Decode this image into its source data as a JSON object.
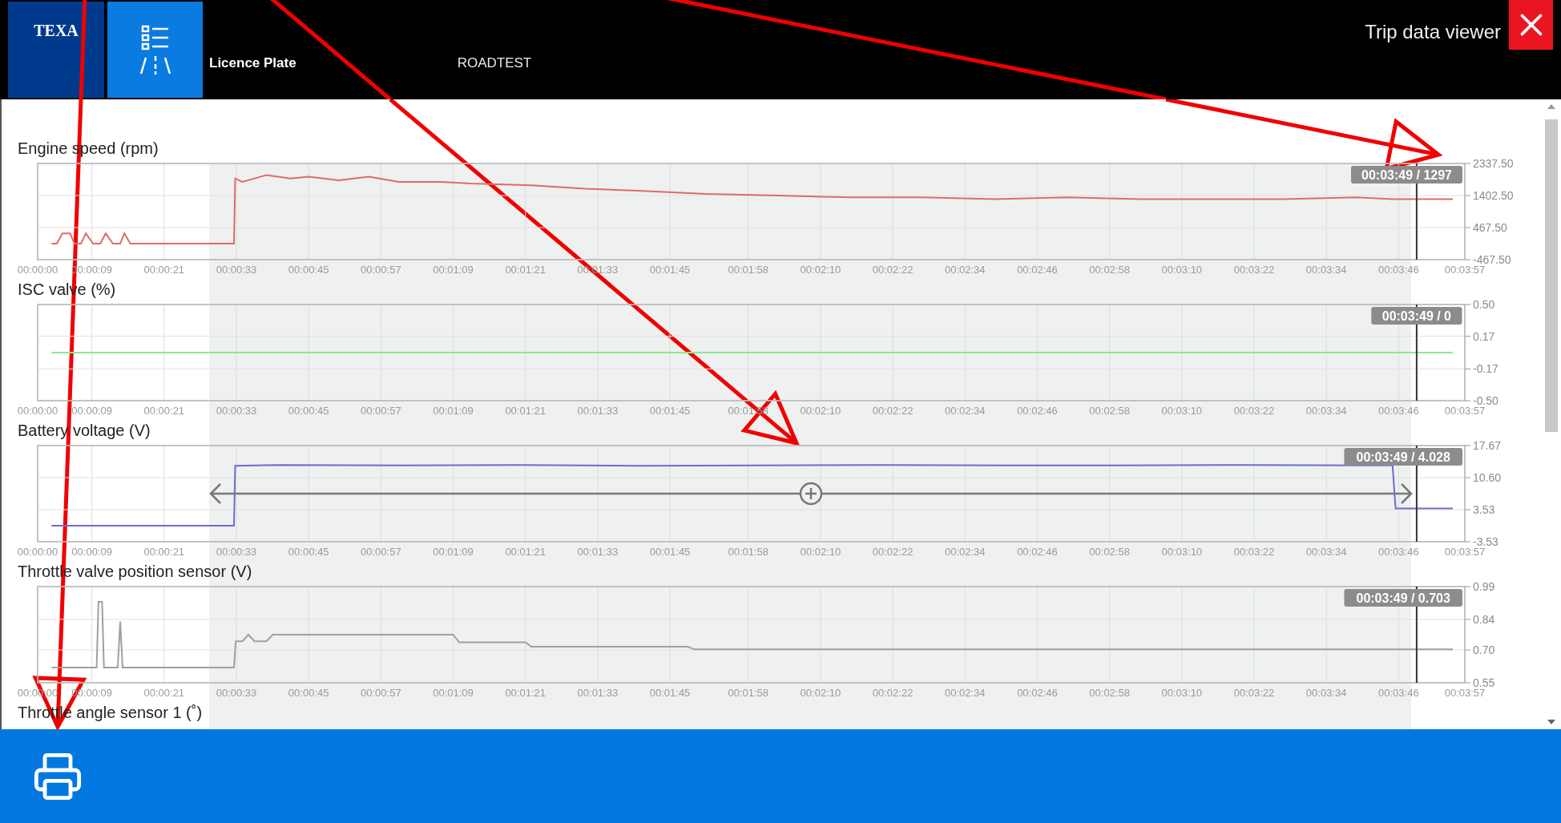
{
  "header": {
    "logo": "TEXA",
    "plate_label": "Licence Plate",
    "plate_value": "ROADTEST",
    "title": "Trip data viewer"
  },
  "charts": [
    {
      "title": "Engine speed (rpm)",
      "chart_data": {
        "type": "line",
        "grid": true,
        "xlim": [
          0,
          237
        ],
        "ylim": [
          -467.5,
          2337.5
        ],
        "x": [
          2.3,
          3.2,
          4.1,
          5.4,
          6.1,
          7.2,
          8.0,
          9.2,
          10.4,
          11.3,
          12.5,
          13.7,
          14.4,
          15.4,
          32.6,
          32.8,
          34,
          38,
          42,
          45,
          50,
          55,
          60,
          67,
          72,
          82,
          91,
          99,
          111,
          123,
          135,
          147,
          159,
          171,
          183,
          195,
          207,
          219,
          225,
          229,
          235
        ],
        "series": [
          {
            "color": "#e06a6a",
            "values": [
              0,
              0,
              300,
              300,
              0,
              0,
              300,
              0,
              0,
              300,
              0,
              0,
              300,
              0,
              0,
              1900,
              1800,
              2000,
              1900,
              1950,
              1850,
              1950,
              1800,
              1800,
              1750,
              1700,
              1600,
              1550,
              1450,
              1400,
              1350,
              1350,
              1300,
              1350,
              1300,
              1300,
              1300,
              1350,
              1300,
              1297,
              1297
            ]
          }
        ],
        "xticks": [
          {
            "value": 0,
            "label": "00:00:00"
          },
          {
            "value": 9,
            "label": "00:00:09"
          },
          {
            "value": 21,
            "label": "00:00:21"
          },
          {
            "value": 33,
            "label": "00:00:33"
          },
          {
            "value": 45,
            "label": "00:00:45"
          },
          {
            "value": 57,
            "label": "00:00:57"
          },
          {
            "value": 69,
            "label": "00:01:09"
          },
          {
            "value": 81,
            "label": "00:01:21"
          },
          {
            "value": 93,
            "label": "00:01:33"
          },
          {
            "value": 105,
            "label": "00:01:45"
          },
          {
            "value": 118,
            "label": "00:01:58"
          },
          {
            "value": 130,
            "label": "00:02:10"
          },
          {
            "value": 142,
            "label": "00:02:22"
          },
          {
            "value": 154,
            "label": "00:02:34"
          },
          {
            "value": 166,
            "label": "00:02:46"
          },
          {
            "value": 178,
            "label": "00:02:58"
          },
          {
            "value": 190,
            "label": "00:03:10"
          },
          {
            "value": 202,
            "label": "00:03:22"
          },
          {
            "value": 214,
            "label": "00:03:34"
          },
          {
            "value": 226,
            "label": "00:03:46"
          },
          {
            "value": 237,
            "label": "00:03:57"
          }
        ],
        "yticks": [
          {
            "value": 2337.5,
            "label": "2337.50"
          },
          {
            "value": 1402.5,
            "label": "1402.50"
          },
          {
            "value": 467.5,
            "label": "467.50"
          },
          {
            "value": -467.5,
            "label": "-467.50"
          }
        ],
        "ref_lines": [
          {
            "axis": "x",
            "value": 229
          }
        ],
        "annotations": [
          {
            "text": "00:03:49 / 1297"
          }
        ]
      }
    },
    {
      "title": "ISC valve (%)",
      "chart_data": {
        "type": "line",
        "grid": true,
        "xlim": [
          0,
          237
        ],
        "ylim": [
          -0.5,
          0.5
        ],
        "x": [
          2.3,
          235
        ],
        "series": [
          {
            "color": "#8ee88e",
            "values": [
              0,
              0
            ]
          }
        ],
        "xticks": [
          {
            "value": 0,
            "label": "00:00:00"
          },
          {
            "value": 9,
            "label": "00:00:09"
          },
          {
            "value": 21,
            "label": "00:00:21"
          },
          {
            "value": 33,
            "label": "00:00:33"
          },
          {
            "value": 45,
            "label": "00:00:45"
          },
          {
            "value": 57,
            "label": "00:00:57"
          },
          {
            "value": 69,
            "label": "00:01:09"
          },
          {
            "value": 81,
            "label": "00:01:21"
          },
          {
            "value": 93,
            "label": "00:01:33"
          },
          {
            "value": 105,
            "label": "00:01:45"
          },
          {
            "value": 118,
            "label": "00:01:58"
          },
          {
            "value": 130,
            "label": "00:02:10"
          },
          {
            "value": 142,
            "label": "00:02:22"
          },
          {
            "value": 154,
            "label": "00:02:34"
          },
          {
            "value": 166,
            "label": "00:02:46"
          },
          {
            "value": 178,
            "label": "00:02:58"
          },
          {
            "value": 190,
            "label": "00:03:10"
          },
          {
            "value": 202,
            "label": "00:03:22"
          },
          {
            "value": 214,
            "label": "00:03:34"
          },
          {
            "value": 226,
            "label": "00:03:46"
          },
          {
            "value": 237,
            "label": "00:03:57"
          }
        ],
        "yticks": [
          {
            "value": 0.5,
            "label": "0.50"
          },
          {
            "value": 0.17,
            "label": "0.17"
          },
          {
            "value": -0.17,
            "label": "-0.17"
          },
          {
            "value": -0.5,
            "label": "-0.50"
          }
        ],
        "ref_lines": [
          {
            "axis": "x",
            "value": 229
          }
        ],
        "annotations": [
          {
            "text": "00:03:49 / 0"
          }
        ]
      }
    },
    {
      "title": "Battery voltage (V)",
      "zoom_handle": true,
      "chart_data": {
        "type": "line",
        "grid": true,
        "xlim": [
          0,
          237
        ],
        "ylim": [
          -3.53,
          17.67
        ],
        "x": [
          2.3,
          32.6,
          32.8,
          40,
          60,
          80,
          100,
          120,
          140,
          160,
          180,
          200,
          220,
          225,
          225.5,
          235
        ],
        "series": [
          {
            "color": "#6b6bd6",
            "values": [
              0,
              0,
              13.2,
              13.4,
              13.3,
              13.4,
              13.2,
              13.3,
              13.4,
              13.3,
              13.3,
              13.4,
              13.3,
              13.3,
              3.8,
              3.8
            ]
          }
        ],
        "xticks": [
          {
            "value": 0,
            "label": "00:00:00"
          },
          {
            "value": 9,
            "label": "00:00:09"
          },
          {
            "value": 21,
            "label": "00:00:21"
          },
          {
            "value": 33,
            "label": "00:00:33"
          },
          {
            "value": 45,
            "label": "00:00:45"
          },
          {
            "value": 57,
            "label": "00:00:57"
          },
          {
            "value": 69,
            "label": "00:01:09"
          },
          {
            "value": 81,
            "label": "00:01:21"
          },
          {
            "value": 93,
            "label": "00:01:33"
          },
          {
            "value": 105,
            "label": "00:01:45"
          },
          {
            "value": 118,
            "label": "00:01:58"
          },
          {
            "value": 130,
            "label": "00:02:10"
          },
          {
            "value": 142,
            "label": "00:02:22"
          },
          {
            "value": 154,
            "label": "00:02:34"
          },
          {
            "value": 166,
            "label": "00:02:46"
          },
          {
            "value": 178,
            "label": "00:02:58"
          },
          {
            "value": 190,
            "label": "00:03:10"
          },
          {
            "value": 202,
            "label": "00:03:22"
          },
          {
            "value": 214,
            "label": "00:03:34"
          },
          {
            "value": 226,
            "label": "00:03:46"
          },
          {
            "value": 237,
            "label": "00:03:57"
          }
        ],
        "yticks": [
          {
            "value": 17.67,
            "label": "17.67"
          },
          {
            "value": 10.6,
            "label": "10.60"
          },
          {
            "value": 3.53,
            "label": "3.53"
          },
          {
            "value": -3.53,
            "label": "-3.53"
          }
        ],
        "ref_lines": [
          {
            "axis": "x",
            "value": 229
          }
        ],
        "annotations": [
          {
            "text": "00:03:49 / 4.028"
          }
        ]
      }
    },
    {
      "title": "Throttle valve position sensor (V)",
      "chart_data": {
        "type": "line",
        "grid": true,
        "xlim": [
          0,
          237
        ],
        "ylim": [
          0.55,
          0.99
        ],
        "x": [
          2.3,
          9.8,
          10.1,
          10.7,
          11.0,
          13.3,
          13.7,
          14.1,
          32.6,
          32.9,
          34,
          35,
          36,
          38,
          39,
          69,
          70,
          81,
          82,
          108,
          109,
          235
        ],
        "series": [
          {
            "color": "#a0a0a0",
            "values": [
              0.62,
              0.62,
              0.92,
              0.92,
              0.62,
              0.62,
              0.83,
              0.62,
              0.62,
              0.74,
              0.74,
              0.77,
              0.74,
              0.74,
              0.77,
              0.77,
              0.735,
              0.735,
              0.715,
              0.715,
              0.703,
              0.703
            ]
          }
        ],
        "xticks": [
          {
            "value": 0,
            "label": "00:00:00"
          },
          {
            "value": 9,
            "label": "00:00:09"
          },
          {
            "value": 21,
            "label": "00:00:21"
          },
          {
            "value": 33,
            "label": "00:00:33"
          },
          {
            "value": 45,
            "label": "00:00:45"
          },
          {
            "value": 57,
            "label": "00:00:57"
          },
          {
            "value": 69,
            "label": "00:01:09"
          },
          {
            "value": 81,
            "label": "00:01:21"
          },
          {
            "value": 93,
            "label": "00:01:33"
          },
          {
            "value": 105,
            "label": "00:01:45"
          },
          {
            "value": 118,
            "label": "00:01:58"
          },
          {
            "value": 130,
            "label": "00:02:10"
          },
          {
            "value": 142,
            "label": "00:02:22"
          },
          {
            "value": 154,
            "label": "00:02:34"
          },
          {
            "value": 166,
            "label": "00:02:46"
          },
          {
            "value": 178,
            "label": "00:02:58"
          },
          {
            "value": 190,
            "label": "00:03:10"
          },
          {
            "value": 202,
            "label": "00:03:22"
          },
          {
            "value": 214,
            "label": "00:03:34"
          },
          {
            "value": 226,
            "label": "00:03:46"
          },
          {
            "value": 237,
            "label": "00:03:57"
          }
        ],
        "yticks": [
          {
            "value": 0.99,
            "label": "0.99"
          },
          {
            "value": 0.84,
            "label": "0.84"
          },
          {
            "value": 0.7,
            "label": "0.70"
          },
          {
            "value": 0.55,
            "label": "0.55"
          }
        ],
        "ref_lines": [
          {
            "axis": "x",
            "value": 229
          }
        ],
        "annotations": [
          {
            "text": "00:03:49 / 0.703"
          }
        ]
      }
    }
  ],
  "next_chart": {
    "title": "Throttle angle sensor 1 (˚)"
  }
}
